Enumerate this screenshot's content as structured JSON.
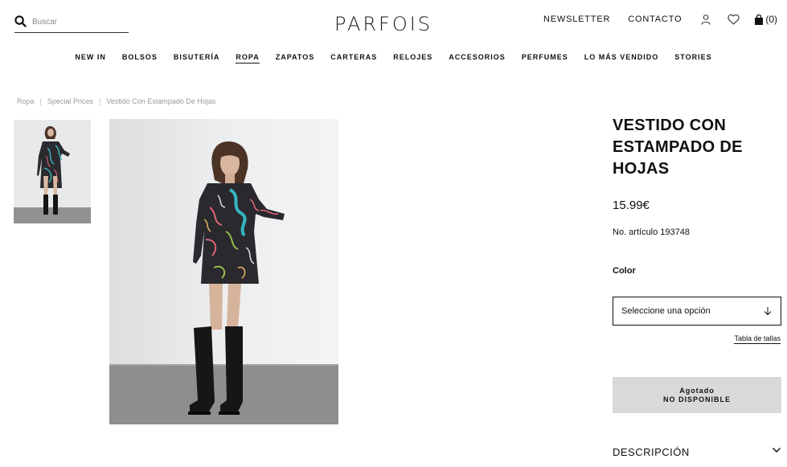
{
  "header": {
    "search_placeholder": "Buscar",
    "logo": "PARFOIS",
    "newsletter": "NEWSLETTER",
    "contact": "CONTACTO",
    "cart_count": "(0)"
  },
  "nav": [
    {
      "label": "NEW IN"
    },
    {
      "label": "BOLSOS"
    },
    {
      "label": "BISUTERÍA"
    },
    {
      "label": "ROPA",
      "active": true
    },
    {
      "label": "ZAPATOS"
    },
    {
      "label": "CARTERAS"
    },
    {
      "label": "RELOJES"
    },
    {
      "label": "ACCESORIOS"
    },
    {
      "label": "PERFUMES"
    },
    {
      "label": "LO MÁS VENDIDO"
    },
    {
      "label": "STORIES"
    }
  ],
  "breadcrumb": [
    "Ropa",
    "Special Prices",
    "Vestido Con Estampado De Hojas"
  ],
  "product": {
    "title": "VESTIDO CON ESTAMPADO DE HOJAS",
    "price": "15.99€",
    "sku_label": "No. artículo",
    "sku": "193748",
    "color_label": "Color",
    "select_placeholder": "Seleccione una opción",
    "size_table": "Tabla de tallas",
    "sold_out_line1": "Agotado",
    "sold_out_line2": "NO DISPONIBLE",
    "description": "DESCRIPCIÓN"
  },
  "colors": {
    "text": "#111111",
    "muted": "#999999",
    "sold_out_bg": "#d9d9d9"
  }
}
